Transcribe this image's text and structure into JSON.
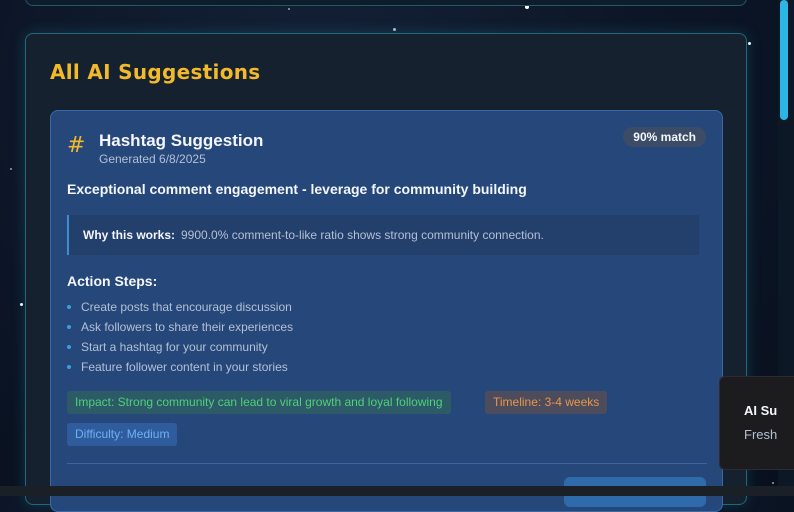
{
  "section": {
    "title": "All AI Suggestions"
  },
  "suggestion": {
    "icon": "hash-icon",
    "title": "Hashtag Suggestion",
    "generated": "Generated 6/8/2025",
    "match": "90% match",
    "headline": "Exceptional comment engagement - leverage for community building",
    "why_label": "Why this works:",
    "why_text": "9900.0% comment-to-like ratio shows strong community connection.",
    "steps_title": "Action Steps:",
    "steps": [
      "Create posts that encourage discussion",
      "Ask followers to share their experiences",
      "Start a hashtag for your community",
      "Feature follower content in your stories"
    ],
    "impact": "Impact: Strong community can lead to viral growth and loyal following",
    "timeline": "Timeline: 3-4 weeks",
    "difficulty": "Difficulty: Medium"
  },
  "toast": {
    "title": "AI Su",
    "subtitle": "Fresh"
  },
  "colors": {
    "accent": "#f2b92b",
    "card_bg": "#26477a",
    "impact": "#4fd07a",
    "timeline": "#e8964a",
    "difficulty": "#6fb0f5",
    "scrollbar": "#2bb6e6"
  }
}
